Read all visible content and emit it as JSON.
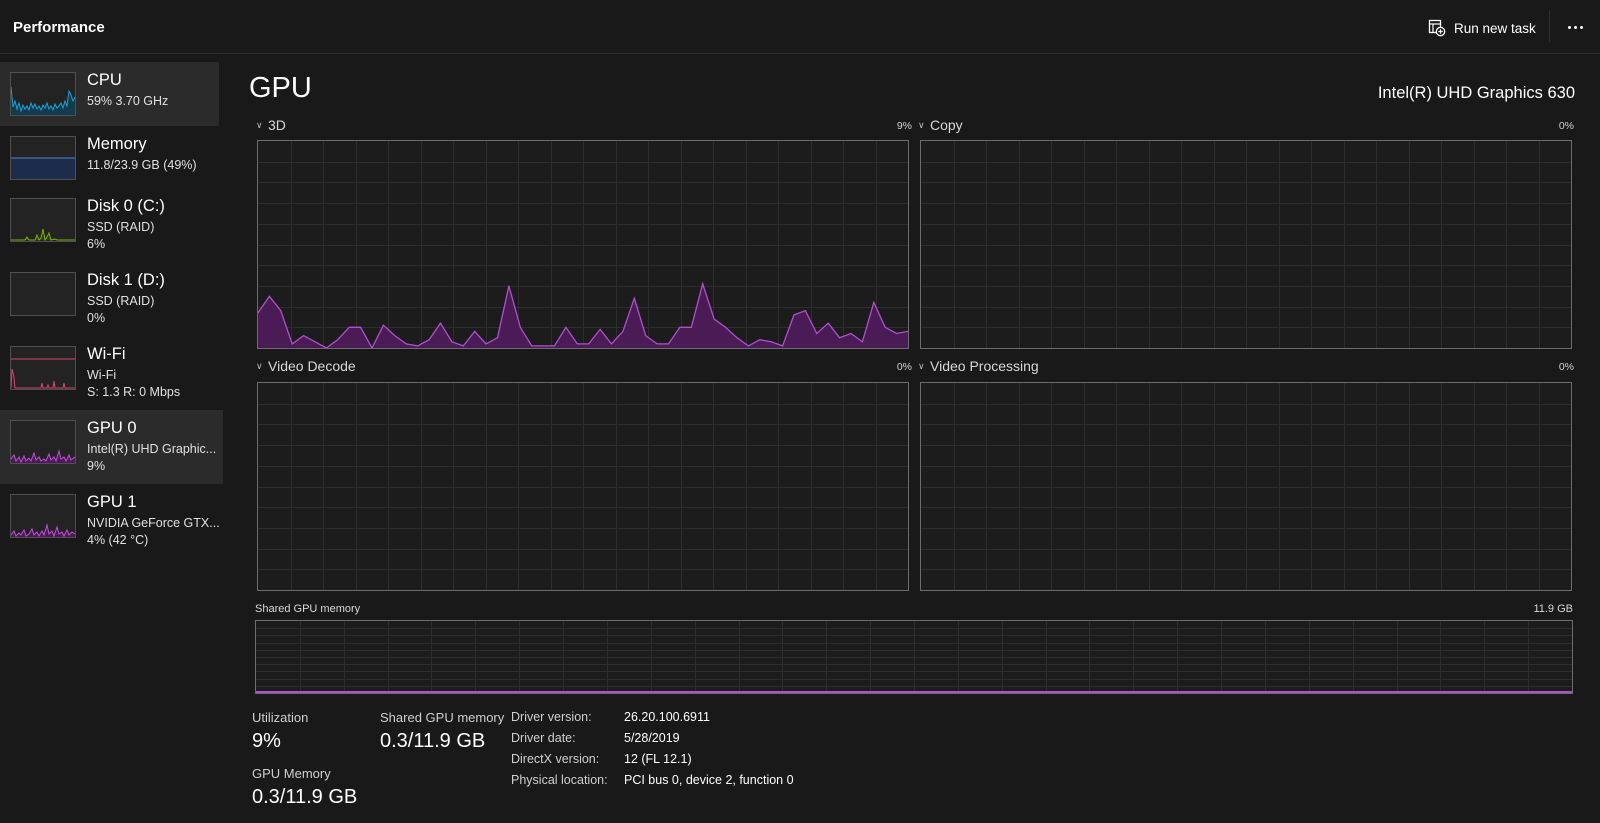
{
  "header": {
    "title": "Performance",
    "run_new_task_label": "Run new task",
    "more_label": "More options"
  },
  "sidebar": {
    "items": [
      {
        "title": "CPU",
        "line1": "59%  3.70 GHz",
        "line2": "",
        "color": "#17a3d6",
        "icon": "cpu-graph"
      },
      {
        "title": "Memory",
        "line1": "11.8/23.9 GB (49%)",
        "line2": "",
        "color": "#5c7ec2",
        "icon": "memory-graph"
      },
      {
        "title": "Disk 0 (C:)",
        "line1": "SSD (RAID)",
        "line2": "6%",
        "color": "#7db200",
        "icon": "disk-graph"
      },
      {
        "title": "Disk 1 (D:)",
        "line1": "SSD (RAID)",
        "line2": "0%",
        "color": "#7db200",
        "icon": "disk-graph"
      },
      {
        "title": "Wi-Fi",
        "line1": "Wi-Fi",
        "line2": "S: 1.3  R: 0 Mbps",
        "color": "#d9456e",
        "icon": "network-graph"
      },
      {
        "title": "GPU 0",
        "line1": "Intel(R) UHD Graphic...",
        "line2": "9%",
        "color": "#b54fcf",
        "icon": "gpu-graph"
      },
      {
        "title": "GPU 1",
        "line1": "NVIDIA GeForce GTX...",
        "line2": "4%  (42 °C)",
        "color": "#b54fcf",
        "icon": "gpu-graph"
      }
    ],
    "selected": "GPU 0"
  },
  "main": {
    "heading": "GPU",
    "adapter_name": "Intel(R) UHD Graphics 630",
    "accent_color": "#b04fd0",
    "fill_color": "#4a1b55",
    "engines": [
      {
        "label": "3D",
        "percent": "9%"
      },
      {
        "label": "Copy",
        "percent": "0%"
      },
      {
        "label": "Video Decode",
        "percent": "0%"
      },
      {
        "label": "Video Processing",
        "percent": "0%"
      }
    ],
    "shared_memory_graph": {
      "label": "Shared GPU memory",
      "max": "11.9 GB"
    }
  },
  "chart_data": {
    "type": "area",
    "title": "3D",
    "ylim": [
      0,
      100
    ],
    "grid": true,
    "series": [
      {
        "values": [
          17,
          25,
          18,
          2,
          6,
          3,
          0,
          4,
          10,
          10,
          0,
          11,
          6,
          2,
          1,
          4,
          12,
          3,
          1,
          8,
          2,
          5,
          30,
          10,
          1,
          1,
          1,
          10,
          2,
          2,
          9,
          2,
          8,
          24,
          6,
          2,
          2,
          10,
          10,
          31,
          14,
          10,
          5,
          1,
          4,
          3,
          1,
          16,
          18,
          7,
          12,
          5,
          7,
          3,
          22,
          10,
          7,
          8
        ]
      }
    ]
  },
  "stats": {
    "utilization_label": "Utilization",
    "utilization_value": "9%",
    "shared_memory_label": "Shared GPU memory",
    "shared_memory_value": "0.3/11.9 GB",
    "gpu_memory_label": "GPU Memory",
    "gpu_memory_value": "0.3/11.9 GB"
  },
  "info": [
    {
      "label": "Driver version:",
      "value": "26.20.100.6911"
    },
    {
      "label": "Driver date:",
      "value": "5/28/2019"
    },
    {
      "label": "DirectX version:",
      "value": "12 (FL 12.1)"
    },
    {
      "label": "Physical location:",
      "value": "PCI bus 0, device 2, function 0"
    }
  ]
}
